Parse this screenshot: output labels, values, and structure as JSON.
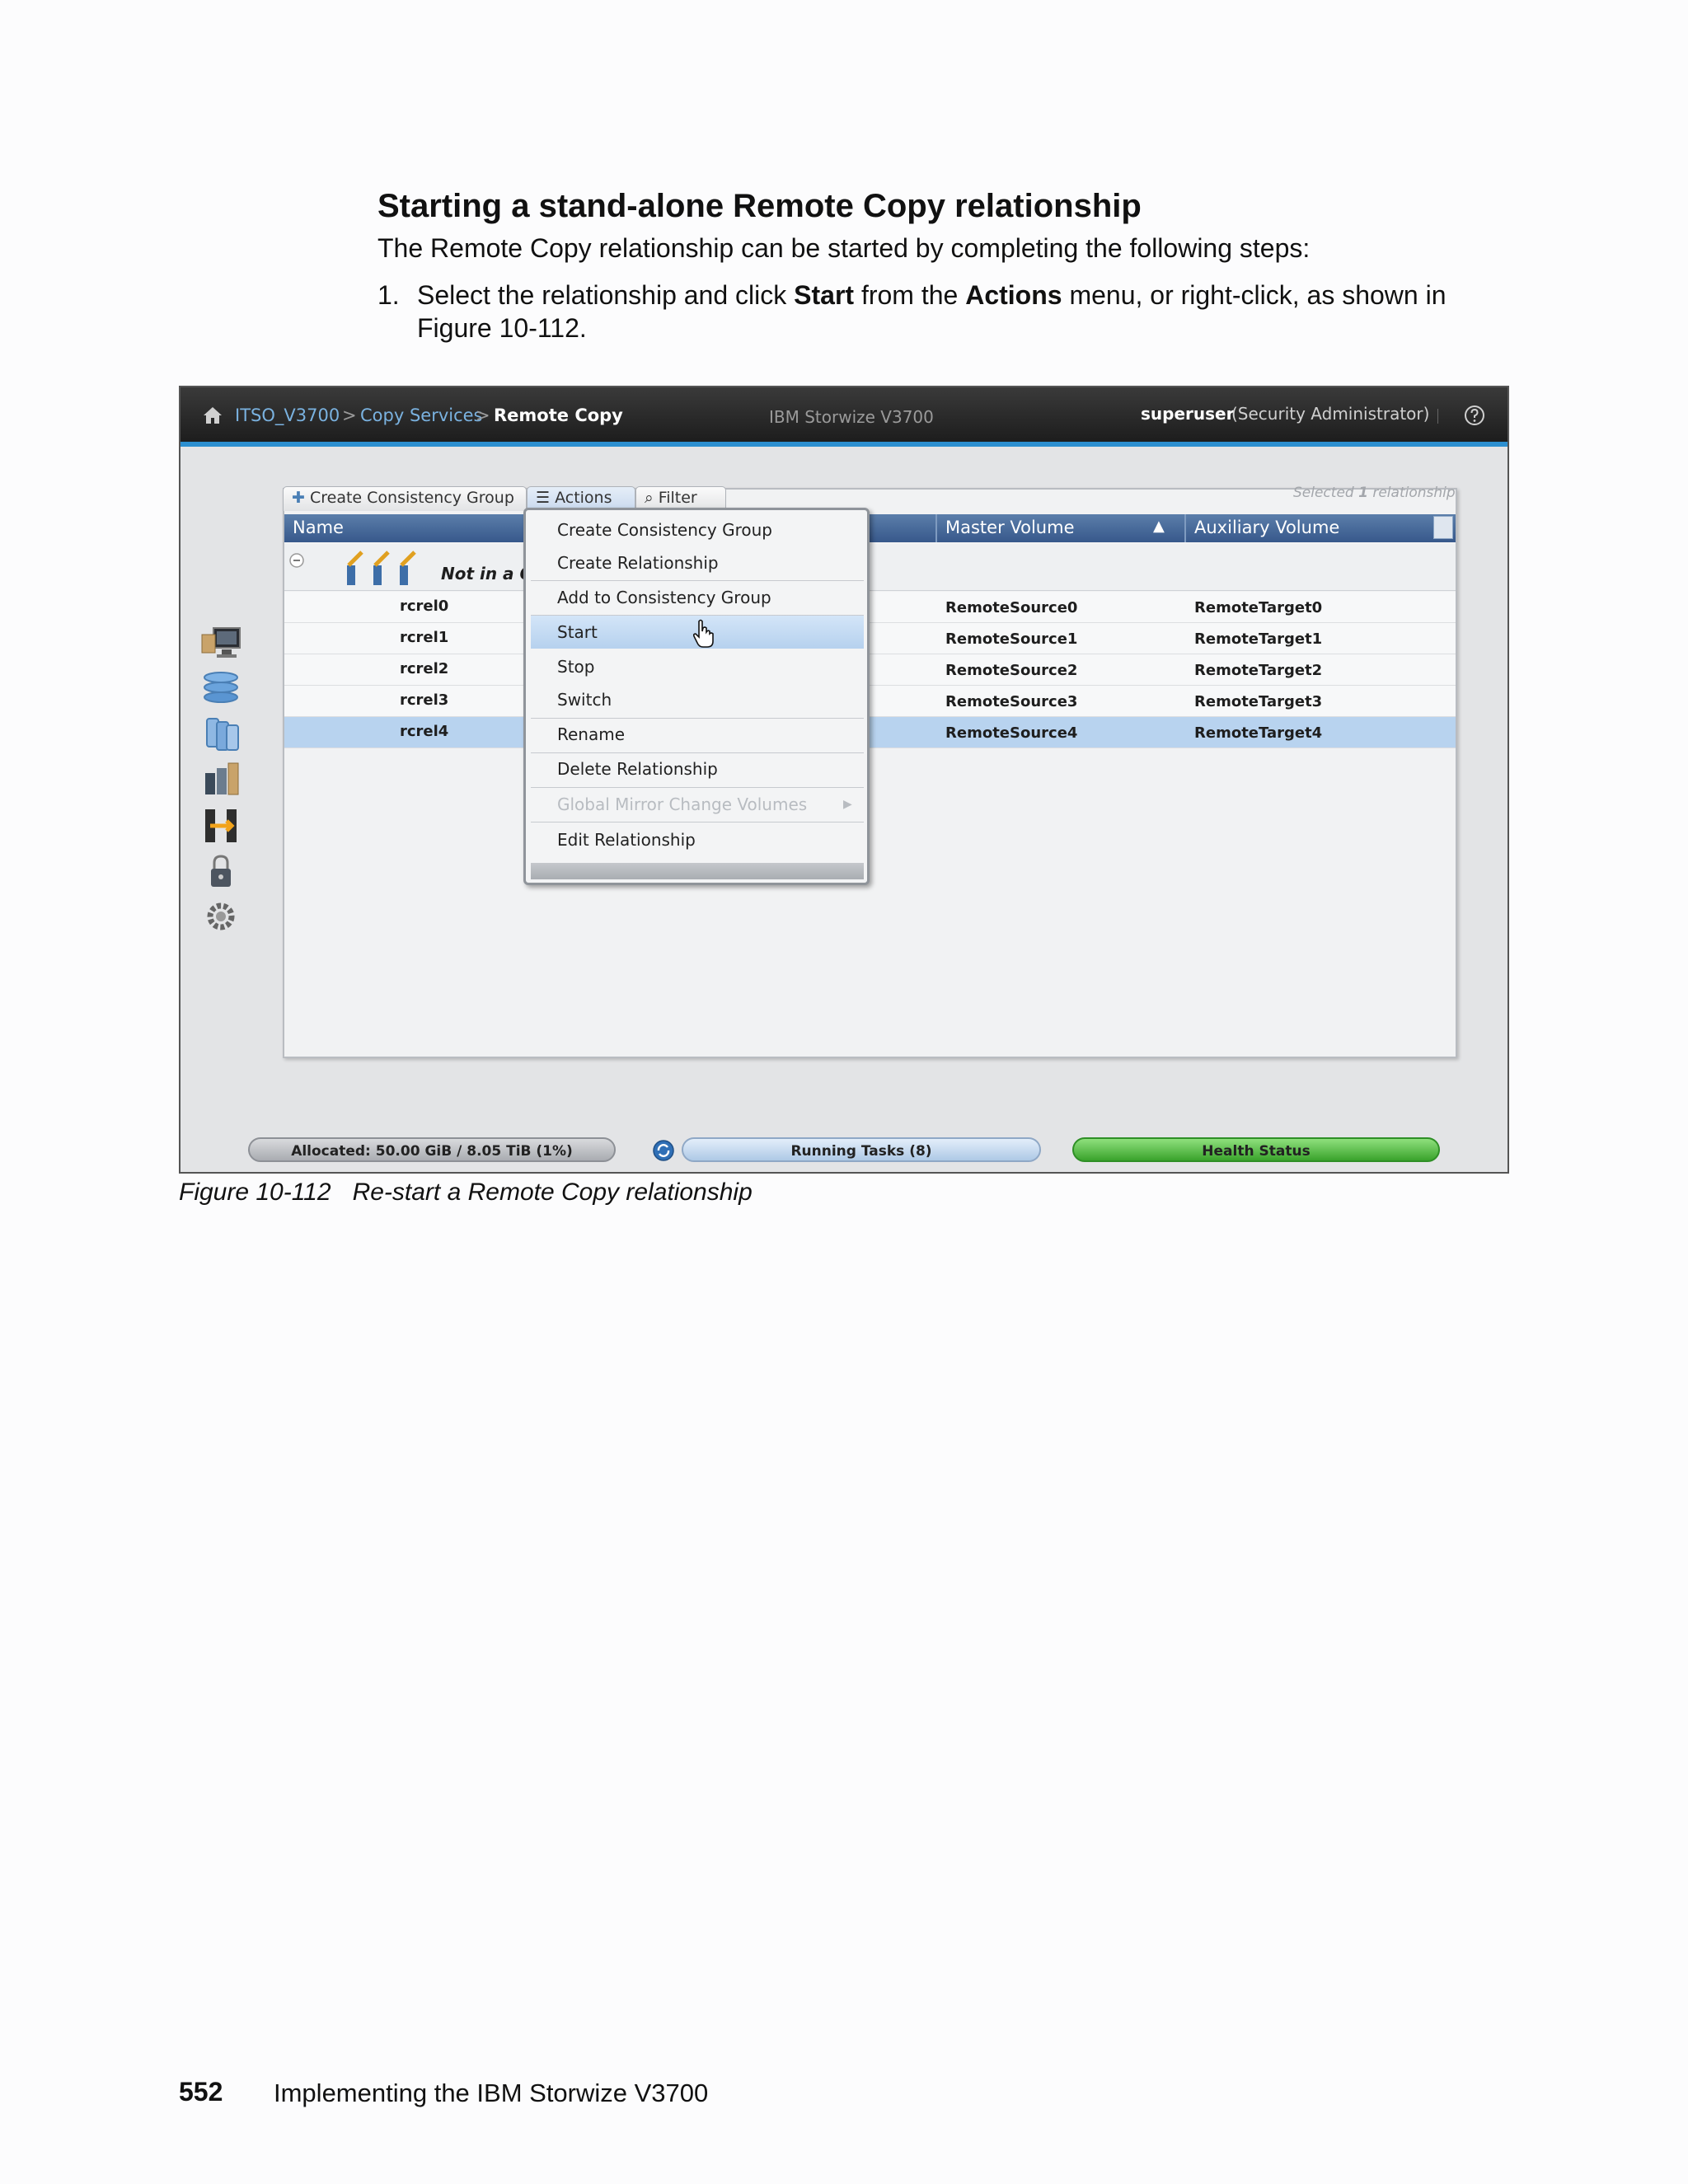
{
  "document": {
    "heading": "Starting a stand-alone Remote Copy relationship",
    "intro": "The Remote Copy relationship can be started by completing the following steps:",
    "step1": {
      "number": "1.",
      "text_a": "Select the relationship and click ",
      "bold_a": "Start",
      "text_b": " from the ",
      "bold_b": "Actions",
      "text_c": " menu, or right-click, as shown in Figure 10-112."
    },
    "caption_label": "Figure 10-112",
    "caption_text": "Re-start a Remote Copy relationship",
    "page_number": "552",
    "book_title": "Implementing the IBM Storwize V3700"
  },
  "screenshot": {
    "breadcrumb": {
      "system": "ITSO_V3700",
      "sep1": ">",
      "section": "Copy Services",
      "sep2": ">",
      "current": "Remote Copy"
    },
    "product": "IBM Storwize V3700",
    "user": "superuser",
    "role": "(Security Administrator)",
    "toolbar": {
      "create_group": "Create Consistency Group",
      "actions": "Actions",
      "filter": "Filter",
      "selected_a": "Selected ",
      "selected_count": "1",
      "selected_b": " relationship"
    },
    "columns": {
      "name": "Name",
      "master": "Master Volume",
      "auxiliary": "Auxiliary Volume"
    },
    "group_label": "Not in a Gr",
    "rows": [
      {
        "name": "rcrel0",
        "master": "RemoteSource0",
        "aux": "RemoteTarget0"
      },
      {
        "name": "rcrel1",
        "master": "RemoteSource1",
        "aux": "RemoteTarget1"
      },
      {
        "name": "rcrel2",
        "master": "RemoteSource2",
        "aux": "RemoteTarget2"
      },
      {
        "name": "rcrel3",
        "master": "RemoteSource3",
        "aux": "RemoteTarget3"
      },
      {
        "name": "rcrel4",
        "master": "RemoteSource4",
        "aux": "RemoteTarget4"
      }
    ],
    "menu": [
      "Create Consistency Group",
      "Create Relationship",
      "Add to Consistency Group",
      "Start",
      "Stop",
      "Switch",
      "Rename",
      "Delete Relationship",
      "Global Mirror Change Volumes",
      "Edit Relationship"
    ],
    "status": {
      "allocated": "Allocated: 50.00 GiB / 8.05 TiB (1%)",
      "tasks": "Running Tasks (8)",
      "health": "Health Status"
    },
    "colors": {
      "header_blue": "#37588b",
      "selected_row": "#b8d3ef",
      "accent_line": "#2c8fd0",
      "health_green": "#3aa32c"
    }
  }
}
